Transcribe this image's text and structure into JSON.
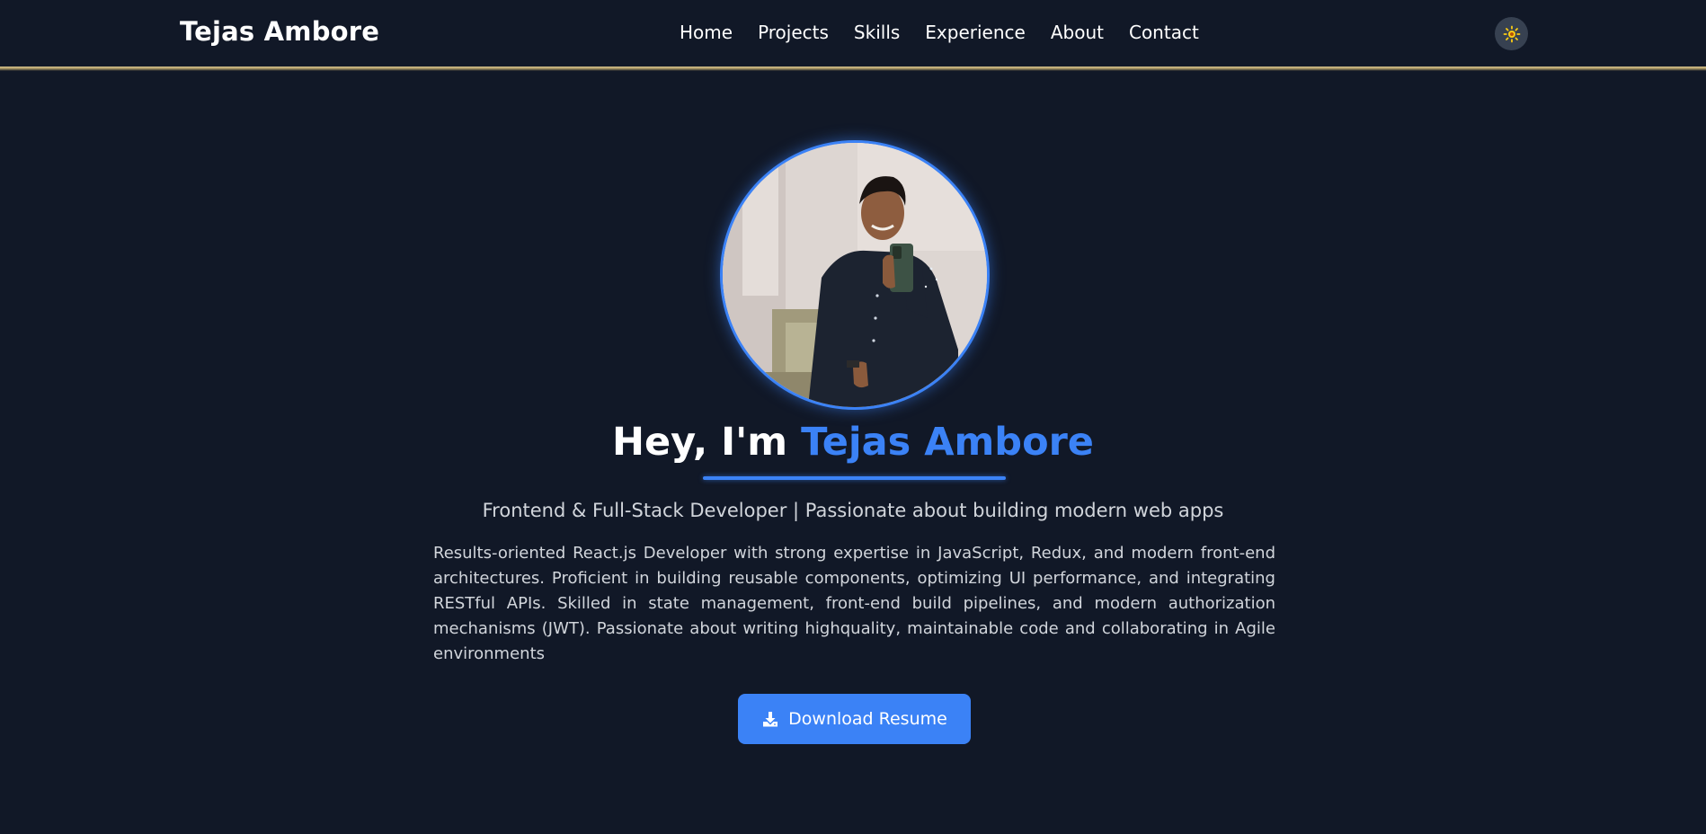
{
  "header": {
    "brand": "Tejas Ambore",
    "nav": [
      {
        "label": "Home"
      },
      {
        "label": "Projects"
      },
      {
        "label": "Skills"
      },
      {
        "label": "Experience"
      },
      {
        "label": "About"
      },
      {
        "label": "Contact"
      }
    ],
    "theme_toggle_icon": "sun-icon"
  },
  "hero": {
    "greeting": "Hey, I'm ",
    "name": "Tejas Ambore",
    "subtitle": "Frontend & Full-Stack Developer | Passionate about building modern web apps",
    "description": "Results-oriented React.js Developer with strong expertise in JavaScript, Redux, and modern front-end architectures. Proficient in building reusable components, optimizing UI performance, and integrating RESTful APIs. Skilled in state management, front-end build pipelines, and modern authorization mechanisms (JWT). Passionate about writing highquality, maintainable code and collaborating in Agile environments",
    "download_button": "Download Resume",
    "download_icon": "download-icon"
  },
  "colors": {
    "background": "#111827",
    "accent": "#3b82f6",
    "navbar_divider": "#c8b27a",
    "text_muted": "#d1d5db",
    "sun": "#facc15"
  }
}
